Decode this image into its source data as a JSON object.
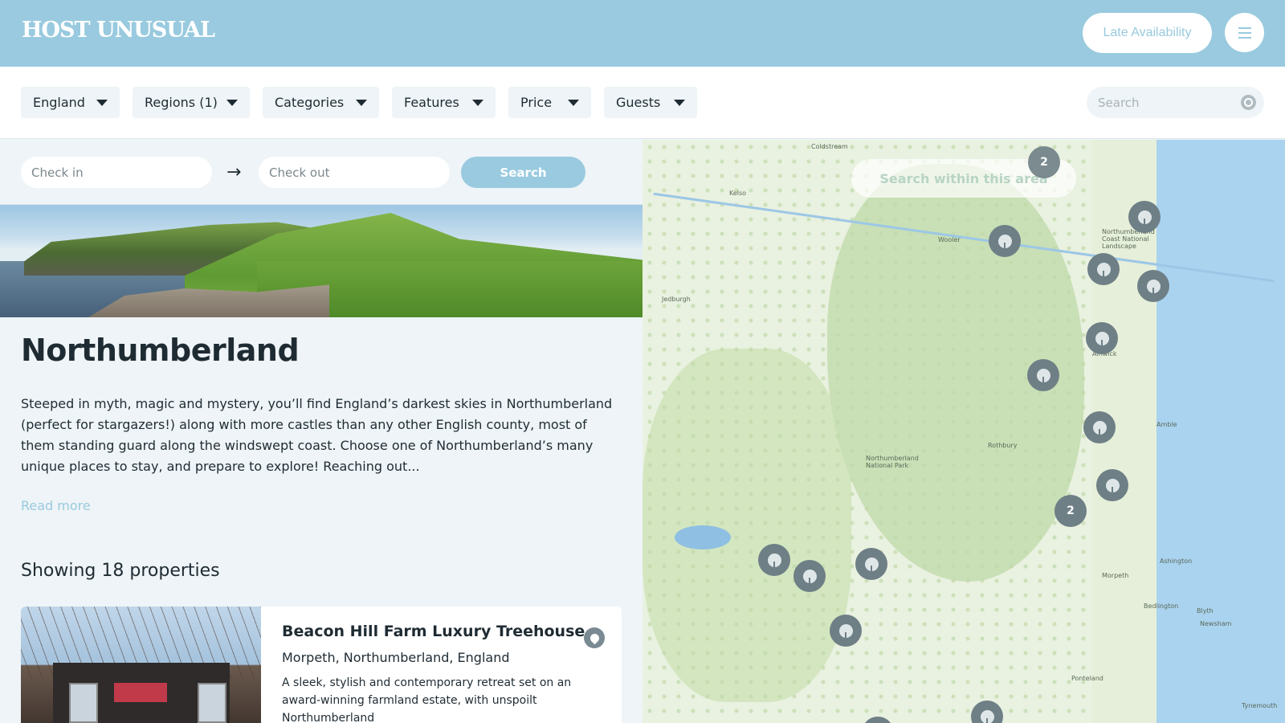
{
  "header": {
    "logo": "HOST UNUSUAL",
    "late_availability": "Late Availability"
  },
  "filters": [
    {
      "label": "England"
    },
    {
      "label": "Regions (1)"
    },
    {
      "label": "Categories"
    },
    {
      "label": "Features"
    },
    {
      "label": "Price"
    },
    {
      "label": "Guests"
    }
  ],
  "search": {
    "placeholder": "Search"
  },
  "dates": {
    "check_in_placeholder": "Check in",
    "check_out_placeholder": "Check out",
    "search_label": "Search"
  },
  "region": {
    "title": "Northumberland",
    "description": "Steeped in myth, magic and mystery, you’ll find England’s darkest skies in Northumberland (perfect for stargazers!) along with more castles than any other English county, most of them standing guard along the windswept coast.  Choose one of Northumberland’s many unique places to stay, and prepare to explore! Reaching out...",
    "read_more": "Read more"
  },
  "results": {
    "count_label": "Showing 18 properties"
  },
  "property": {
    "title": "Beacon Hill Farm Luxury Treehouse",
    "location": "Morpeth, Northumberland, England",
    "description": "A sleek, stylish and contemporary retreat set on an award-winning farmland estate, with unspoilt Northumberland"
  },
  "map": {
    "search_area_label": "Search within this area",
    "places": [
      {
        "name": "Coldstream"
      },
      {
        "name": "Kelso"
      },
      {
        "name": "Wooler"
      },
      {
        "name": "Jedburgh"
      },
      {
        "name": "Northumberland Coast National Landscape"
      },
      {
        "name": "Alnwick"
      },
      {
        "name": "Amble"
      },
      {
        "name": "Rothbury"
      },
      {
        "name": "Northumberland National Park"
      },
      {
        "name": "Ashington"
      },
      {
        "name": "Morpeth"
      },
      {
        "name": "Bedlington"
      },
      {
        "name": "Blyth"
      },
      {
        "name": "Newsham"
      },
      {
        "name": "Ponteland"
      },
      {
        "name": "Tynemouth"
      }
    ],
    "clusters": [
      {
        "count": "2"
      },
      {
        "count": "2"
      }
    ]
  },
  "colors": {
    "accent": "#99cadf",
    "header_bg": "#99cadf",
    "pin": "#6e7f86"
  }
}
